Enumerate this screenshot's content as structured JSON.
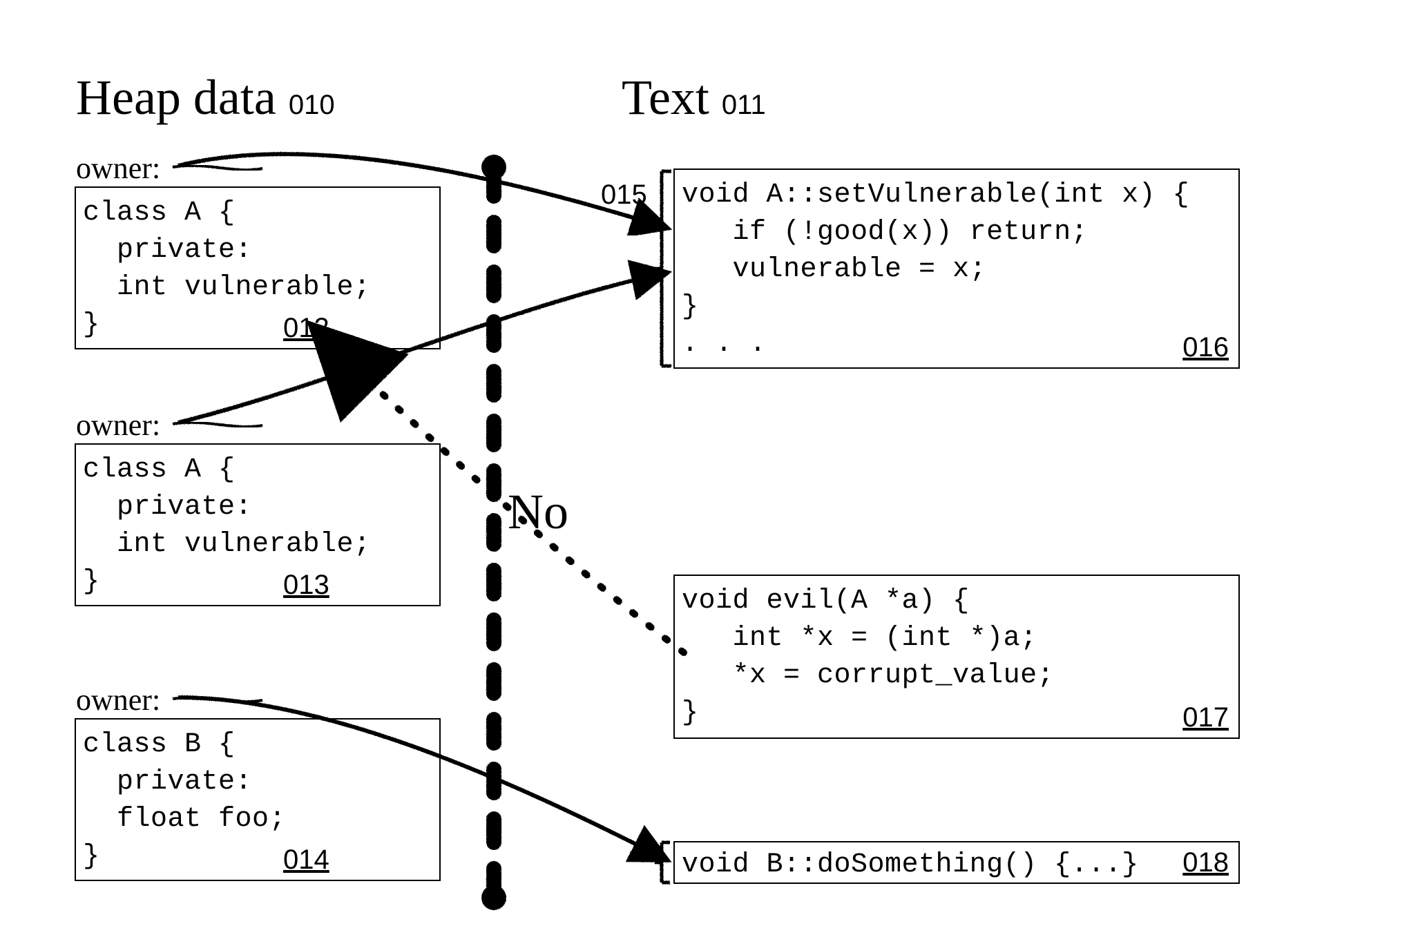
{
  "headings": {
    "heap": "Heap data",
    "heap_ref": "010",
    "text": "Text",
    "text_ref": "011"
  },
  "owners": {
    "label": "owner:"
  },
  "heap_boxes": {
    "a1": {
      "code": "class A {\n  private:\n  int vulnerable;\n}",
      "ref": "012"
    },
    "a2": {
      "code": "class A {\n  private:\n  int vulnerable;\n}",
      "ref": "013"
    },
    "b": {
      "code": "class B {\n  private:\n  float foo;\n}",
      "ref": "014"
    }
  },
  "text_boxes": {
    "setVulnerable": {
      "code": "void A::setVulnerable(int x) {\n   if (!good(x)) return;\n   vulnerable = x;\n}\n. . .",
      "ref": "016",
      "bracket_ref": "015"
    },
    "evil": {
      "code": "void evil(A *a) {\n   int *x = (int *)a;\n   *x = corrupt_value;\n}",
      "ref": "017"
    },
    "doSomething": {
      "code": "void B::doSomething() {...}",
      "ref": "018"
    }
  },
  "center": {
    "no": "No"
  }
}
